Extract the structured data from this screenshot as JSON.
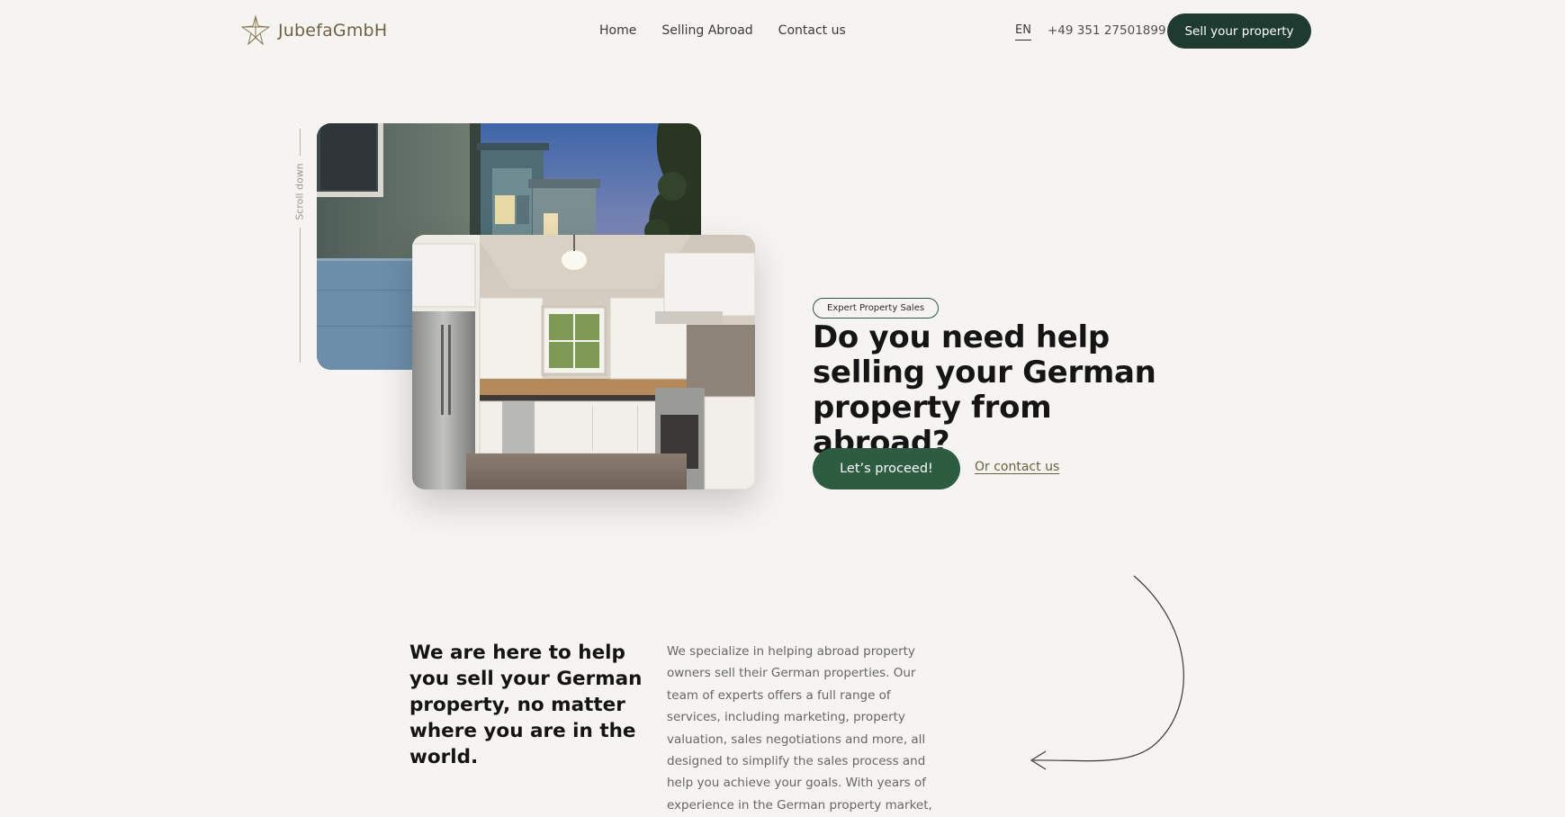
{
  "header": {
    "logo_text": "JubefaGmbH",
    "nav": [
      {
        "label": "Home"
      },
      {
        "label": "Selling Abroad"
      },
      {
        "label": "Contact us"
      }
    ],
    "language": "EN",
    "phone": "+49 351 27501899",
    "cta_label": "Sell your property"
  },
  "hero": {
    "scroll_label": "Scroll down",
    "badge": "Expert Property Sales",
    "title": "Do you need help selling your German property from abroad?",
    "primary_button": "Let’s proceed!",
    "secondary_link": "Or contact us"
  },
  "about": {
    "title": "We are here to help you sell your German property, no matter where you are in the world.",
    "text": "We specialize in helping abroad property owners sell their German properties. Our team of experts offers a full range of services, including marketing, property valuation, sales negotiations and more, all designed to simplify the sales process and help you achieve your goals. With years of experience in the German property market,"
  },
  "colors": {
    "background": "#f6f4f0",
    "primary_dark": "#1f3a30",
    "primary_green": "#2d5c41",
    "logo_gold": "#6f6246"
  },
  "icons": {
    "logo": "star-crown-logo-icon",
    "decorative_arrow": "curved-arrow-left-icon"
  }
}
